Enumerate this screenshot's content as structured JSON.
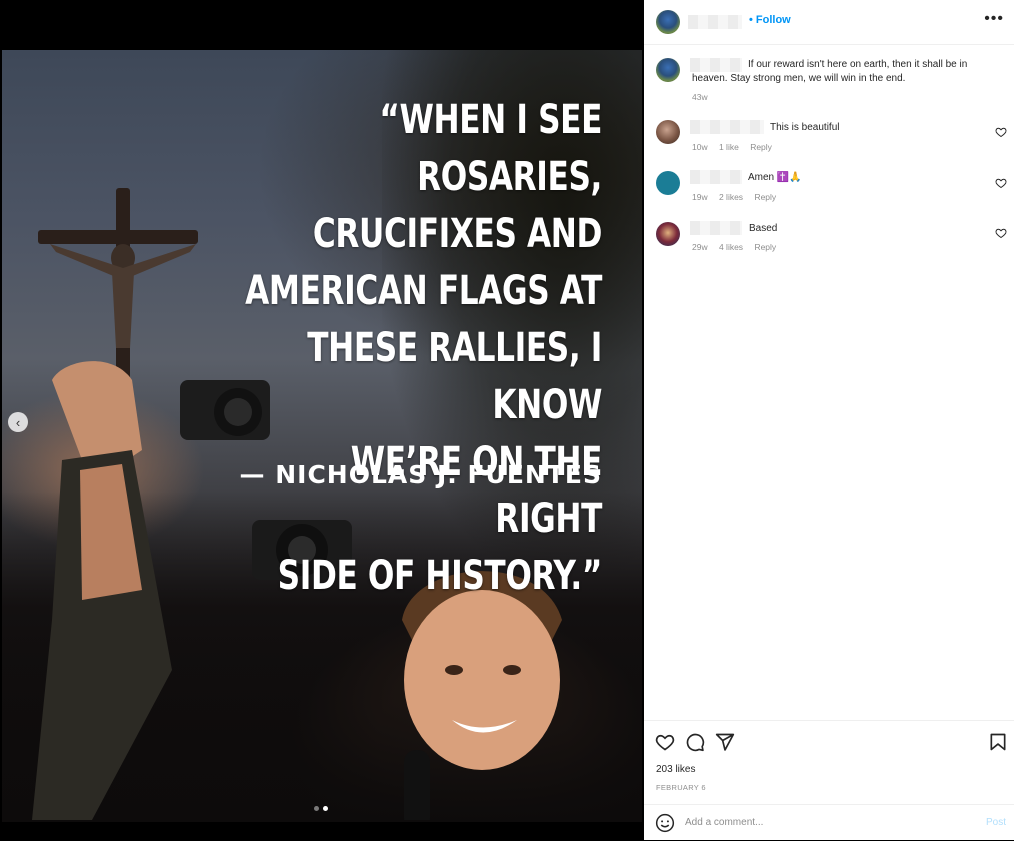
{
  "post": {
    "quote_lines": [
      "“WHEN I SEE ROSARIES,",
      "CRUCIFIXES AND",
      "AMERICAN FLAGS AT",
      "THESE RALLIES, I KNOW",
      "WE’RE ON THE RIGHT",
      "SIDE OF HISTORY.”"
    ],
    "author": "— NICHOLAS J. FUENTES",
    "carousel": {
      "slides": 2,
      "active_slide": 2
    }
  },
  "header": {
    "follow_label": "• Follow",
    "more_icon": "more-horizontal-icon"
  },
  "comments": [
    {
      "text": "If our reward isn't here on earth, then it shall be in heaven. Stay strong men, we will win in the end.",
      "time": "43w",
      "likes": "",
      "reply": ""
    },
    {
      "text": "This is beautiful",
      "time": "10w",
      "likes": "1 like",
      "reply": "Reply"
    },
    {
      "text": "Amen ✝️🙏",
      "time": "19w",
      "likes": "2 likes",
      "reply": "Reply"
    },
    {
      "text": "Based",
      "time": "29w",
      "likes": "4 likes",
      "reply": "Reply"
    }
  ],
  "actions": {
    "likes": "203 likes",
    "date": "FEBRUARY 6",
    "icons": [
      "heart-icon",
      "comment-icon",
      "share-icon",
      "bookmark-icon"
    ]
  },
  "add_comment": {
    "placeholder": "Add a comment...",
    "post_label": "Post"
  },
  "colors": {
    "accent": "#0095f6",
    "post_disabled": "#b2dffc",
    "meta": "#8e8e8e"
  }
}
